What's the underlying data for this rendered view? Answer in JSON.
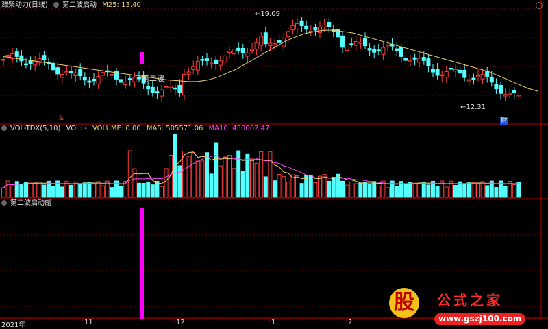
{
  "header": {
    "main": {
      "stock_name": "潍柴动力(日线)",
      "indicator_name": "第二波启动",
      "ma_label": "M25: 13.40"
    },
    "volume": {
      "indicator_name": "VOL-TDX(5,10)",
      "vol_label": "VOL: -",
      "volume_label": "VOLUME: 0.00",
      "ma5_label": "MA5: 505571.06",
      "ma10_label": "MA10: 450062.47"
    },
    "signal": {
      "indicator_name": "第二波启动副"
    }
  },
  "annotations": {
    "high_label": "19.09",
    "low_label": "12.31",
    "signal_label": "第二波",
    "finance_badge": "财",
    "red_marker": "&"
  },
  "x_axis": {
    "labels": [
      "2021年",
      "11",
      "12",
      "1",
      "2"
    ]
  },
  "logo": {
    "badge": "股",
    "name": "公式之家",
    "url": "www.gszj100.com"
  },
  "colors": {
    "up": "#ff3b3b",
    "down": "#54ffff",
    "ma25": "#e8d36a",
    "ma5": "#e8d36a",
    "ma10": "#ff44ff",
    "signal": "#ff00ff",
    "grid": "#7a0000",
    "text": "#cccccc"
  },
  "chart_data": [
    {
      "type": "candlestick",
      "title": "第二波启动",
      "series": [
        {
          "name": "M25",
          "values": [
            15.9,
            15.8,
            15.7,
            15.6,
            15.5,
            15.4,
            15.3,
            15.2,
            15.1,
            15.0,
            14.9,
            14.8,
            14.7,
            14.6,
            14.5,
            14.4,
            14.3,
            14.2,
            14.15,
            14.1,
            14.1,
            14.2,
            14.4,
            14.7,
            15.0,
            15.4,
            15.8,
            16.2,
            16.6,
            17.0,
            17.3,
            17.55,
            17.7,
            17.8,
            17.8,
            17.7,
            17.6,
            17.4,
            17.2,
            17.0,
            16.8,
            16.6,
            16.4,
            16.2,
            16.0,
            15.8,
            15.6,
            15.4,
            15.2,
            15.0,
            14.8,
            14.5,
            14.2,
            13.9,
            13.6,
            13.4
          ]
        }
      ],
      "annotations": {
        "max": 19.09,
        "min": 12.31
      }
    },
    {
      "type": "bar",
      "title": "VOL-TDX(5,10)",
      "series": [
        {
          "name": "MA5",
          "value": 505571.06
        },
        {
          "name": "MA10",
          "value": 450062.47
        }
      ]
    },
    {
      "type": "bar",
      "title": "第二波启动副",
      "series": [
        {
          "name": "第二波启动副",
          "signal_index": 1,
          "value": 1
        }
      ]
    }
  ]
}
